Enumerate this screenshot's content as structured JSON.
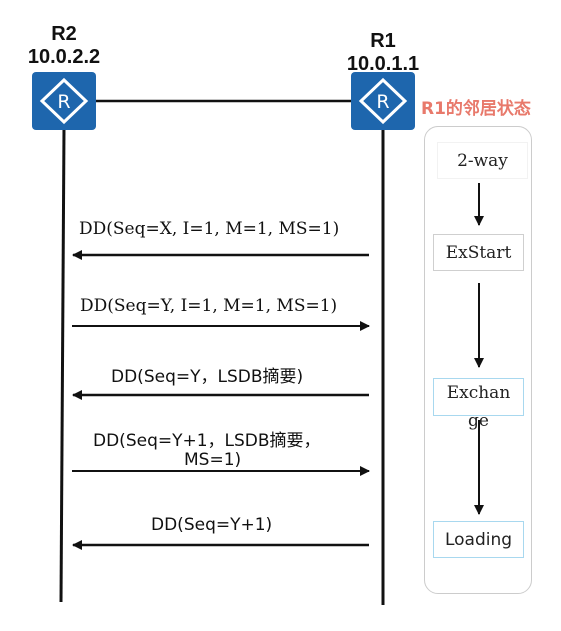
{
  "routers": {
    "r2": {
      "name": "R2",
      "ip": "10.0.2.2"
    },
    "r1": {
      "name": "R1",
      "ip": "10.0.1.1"
    }
  },
  "messages": [
    {
      "text": "DD(Seq=X, I=1, M=1, MS=1)",
      "direction": "R1 to R2"
    },
    {
      "text": "DD(Seq=Y, I=1, M=1, MS=1)",
      "direction": "R2 to R1"
    },
    {
      "text": "DD(Seq=Y，LSDB摘要)",
      "direction": "R1 to R2"
    },
    {
      "line1": "DD(Seq=Y+1，LSDB摘要，",
      "line2": "MS=1)",
      "direction": "R2 to R1"
    },
    {
      "text": "DD(Seq=Y+1)",
      "direction": "R1 to R2"
    }
  ],
  "state_panel": {
    "title": "R1的邻居状态",
    "states": [
      "2-way",
      "ExStart",
      "Exchan ge",
      "Loading"
    ]
  },
  "colors": {
    "router_blue": "#1e66ad",
    "title_red": "#e8796b",
    "state_border_light": "#a8d8ef"
  }
}
